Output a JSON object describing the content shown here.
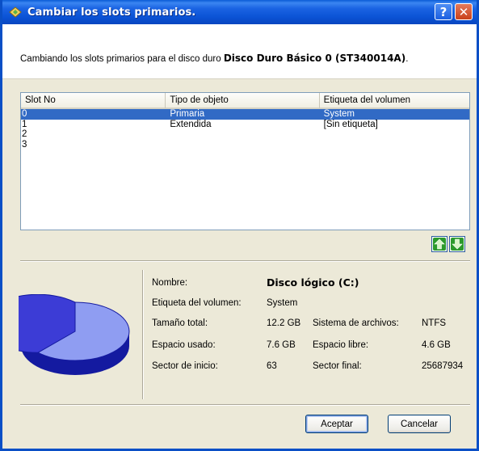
{
  "dialog": {
    "title": "Cambiar los slots primarios.",
    "help_label": "?",
    "close_label": "✕"
  },
  "intro": {
    "prefix": "Cambiando los slots primarios para el disco duro ",
    "disk_name": "Disco Duro Básico 0 (ST340014A)",
    "suffix": "."
  },
  "table": {
    "headers": [
      "Slot No",
      "Tipo de objeto",
      "Etiqueta del volumen"
    ],
    "rows": [
      {
        "slot": "0",
        "tipo": "Primaria",
        "etiqueta": "System",
        "selected": true
      },
      {
        "slot": "1",
        "tipo": "Extendida",
        "etiqueta": "[Sin etiqueta]",
        "selected": false
      },
      {
        "slot": "2",
        "tipo": "",
        "etiqueta": "",
        "selected": false
      },
      {
        "slot": "3",
        "tipo": "",
        "etiqueta": "",
        "selected": false
      }
    ]
  },
  "move_buttons": {
    "up_icon": "green-up-arrow",
    "down_icon": "green-down-arrow"
  },
  "details": {
    "nombre_label": "Nombre:",
    "nombre_value": "Disco lógico (C:)",
    "etiqueta_label": "Etiqueta del volumen:",
    "etiqueta_value": "System",
    "tamano_label": "Tamaño total:",
    "tamano_value": "12.2 GB",
    "sistema_label": "Sistema de archivos:",
    "sistema_value": "NTFS",
    "usado_label": "Espacio usado:",
    "usado_value": "7.6 GB",
    "libre_label": "Espacio libre:",
    "libre_value": "4.6 GB",
    "inicio_label": "Sector de inicio:",
    "inicio_value": "63",
    "final_label": "Sector final:",
    "final_value": "25687934",
    "used_fraction": 0.62
  },
  "buttons": {
    "accept": "Aceptar",
    "cancel": "Cancelar"
  },
  "colors": {
    "title_blue": "#0a5bd6",
    "selection": "#316ac5",
    "pie_used": "#3c3cd6",
    "pie_free": "#8f9df2"
  }
}
